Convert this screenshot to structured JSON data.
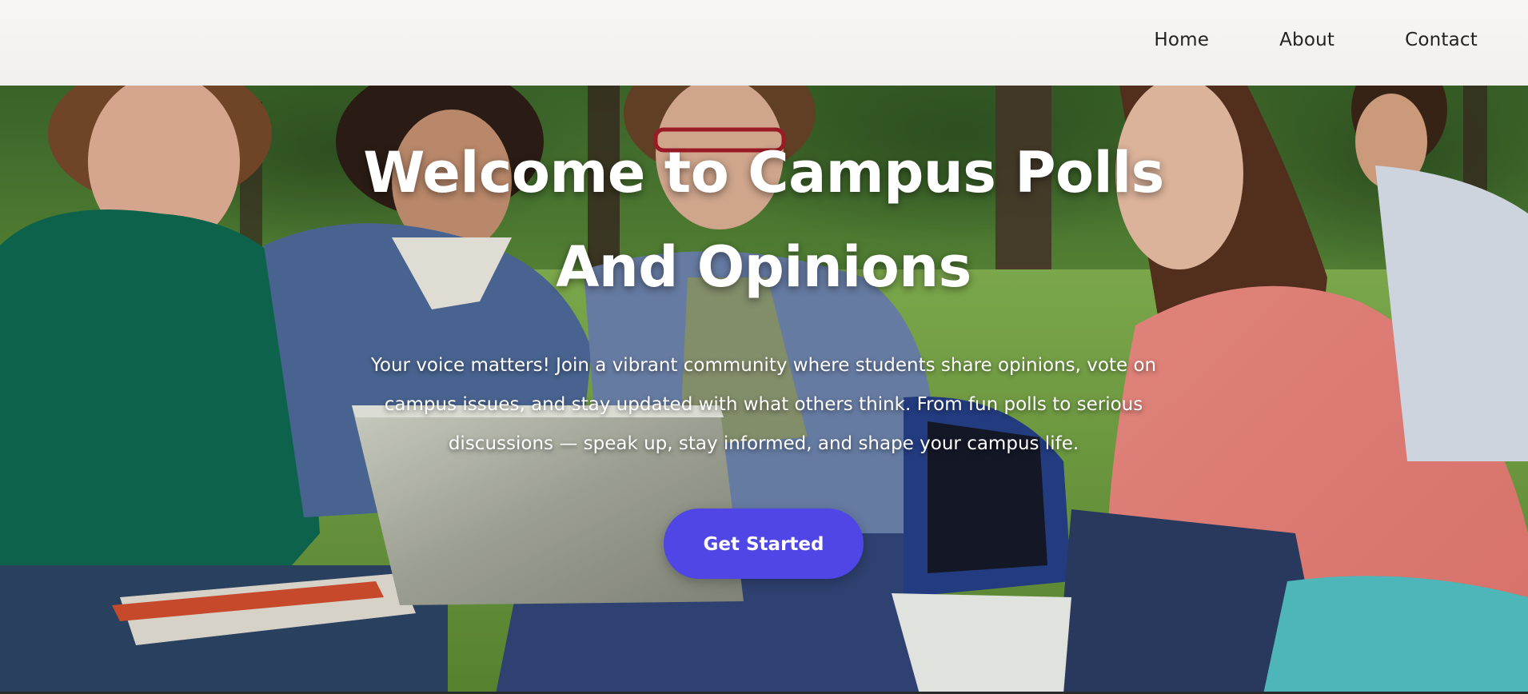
{
  "nav": {
    "items": [
      {
        "label": "Home"
      },
      {
        "label": "About"
      },
      {
        "label": "Contact"
      }
    ]
  },
  "hero": {
    "title_line1": "Welcome to Campus Polls",
    "title_line2": "And Opinions",
    "subtitle": "Your voice matters! Join a vibrant community where students share opinions, vote on campus issues, and stay updated with what others think. From fun polls to serious discussions — speak up, stay informed, and shape your campus life.",
    "cta_label": "Get Started"
  },
  "colors": {
    "accent": "#4f46e5",
    "nav_background": "#f4f3f1",
    "hero_text": "#ffffff"
  }
}
